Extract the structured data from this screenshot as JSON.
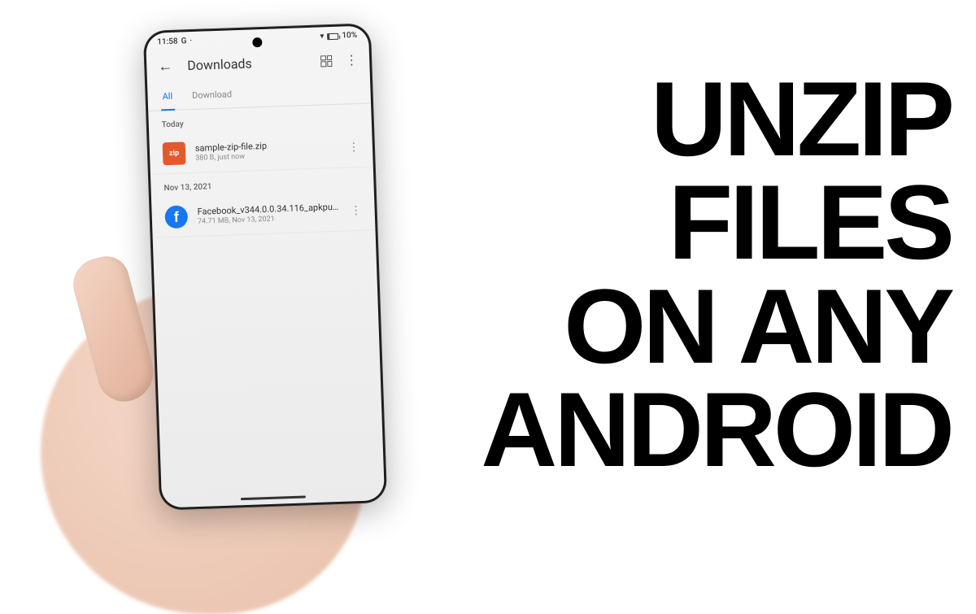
{
  "status_bar": {
    "time": "11:58",
    "indicator": "G",
    "battery_pct": "10%"
  },
  "header": {
    "title": "Downloads"
  },
  "tabs": {
    "all": "All",
    "download": "Download"
  },
  "sections": [
    {
      "label": "Today",
      "files": [
        {
          "name": "sample-zip-file.zip",
          "meta": "380 B, just now",
          "icon_type": "zip"
        }
      ]
    },
    {
      "label": "Nov 13, 2021",
      "files": [
        {
          "name": "Facebook_v344.0.0.34.116_apkpure....",
          "meta": "74.71 MB, Nov 13, 2021",
          "icon_type": "fb"
        }
      ]
    }
  ],
  "headline": {
    "line1": "UNZIP",
    "line2": "FILES",
    "line3": "ON ANY",
    "line4": "ANDROID"
  }
}
